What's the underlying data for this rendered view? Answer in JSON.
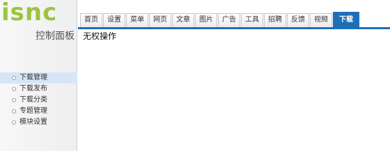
{
  "logo": {
    "text": "isnc"
  },
  "sidebar": {
    "title": "控制面板",
    "items": [
      {
        "label": "下载管理",
        "active": true
      },
      {
        "label": "下载发布",
        "active": false
      },
      {
        "label": "下载分类",
        "active": false
      },
      {
        "label": "专题管理",
        "active": false
      },
      {
        "label": "模块设置",
        "active": false
      }
    ]
  },
  "tabs": [
    {
      "label": "首页",
      "active": false
    },
    {
      "label": "设置",
      "active": false
    },
    {
      "label": "菜单",
      "active": false
    },
    {
      "label": "网页",
      "active": false
    },
    {
      "label": "文章",
      "active": false
    },
    {
      "label": "图片",
      "active": false
    },
    {
      "label": "广告",
      "active": false
    },
    {
      "label": "工具",
      "active": false
    },
    {
      "label": "招聘",
      "active": false
    },
    {
      "label": "反馈",
      "active": false
    },
    {
      "label": "视频",
      "active": false
    },
    {
      "label": "下载",
      "active": true
    }
  ],
  "content": {
    "message": "无权操作"
  },
  "colors": {
    "accent": "#1e6fb8",
    "logo": "#9bc43c",
    "active_item_bg": "#d6e6f7"
  }
}
